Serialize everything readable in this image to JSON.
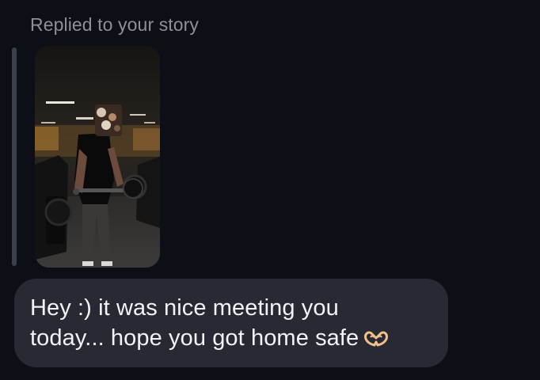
{
  "reply_label": "Replied to your story",
  "story": {
    "icon": "story-photo-gym"
  },
  "message": {
    "line1": "Hey :) it was nice meeting you",
    "line2": "today... hope you got home safe",
    "emoji_icon": "heart-hands-icon"
  },
  "colors": {
    "background": "#0d0f16",
    "bubble": "#272a33",
    "label": "#8d909a",
    "text": "#f2f3f6",
    "reply_bar": "#3b3f4b"
  }
}
